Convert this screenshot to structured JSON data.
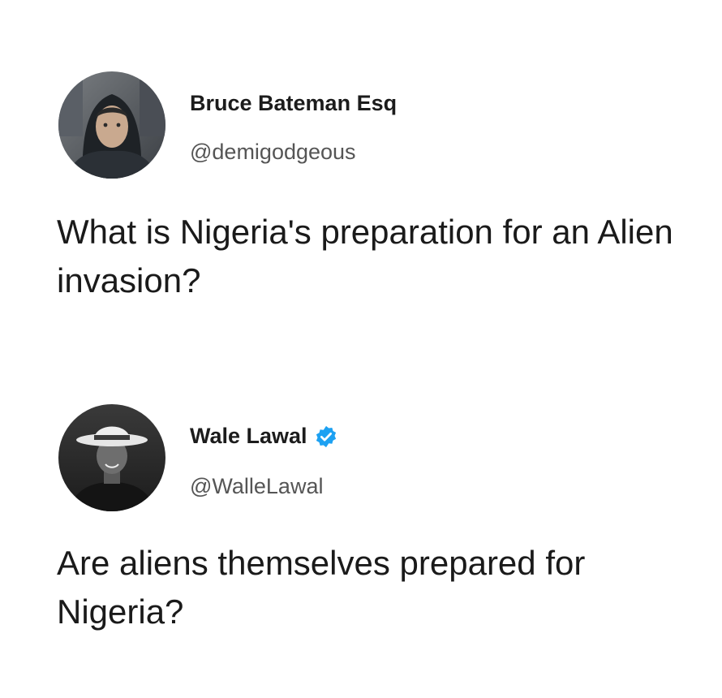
{
  "tweets": [
    {
      "display_name": "Bruce Bateman Esq",
      "handle": "@demigodgeous",
      "text": "What is Nigeria's preparation for an Alien invasion?",
      "verified": false
    },
    {
      "display_name": "Wale Lawal",
      "handle": "@WalleLawal",
      "text": "Are aliens themselves prepared for Nigeria?",
      "verified": true
    }
  ],
  "icons": {
    "verified_badge": "verified-badge-icon"
  },
  "colors": {
    "background": "#ffffff",
    "text": "#1a1a1a",
    "handle": "#555555",
    "verified": "#1da1f2"
  }
}
